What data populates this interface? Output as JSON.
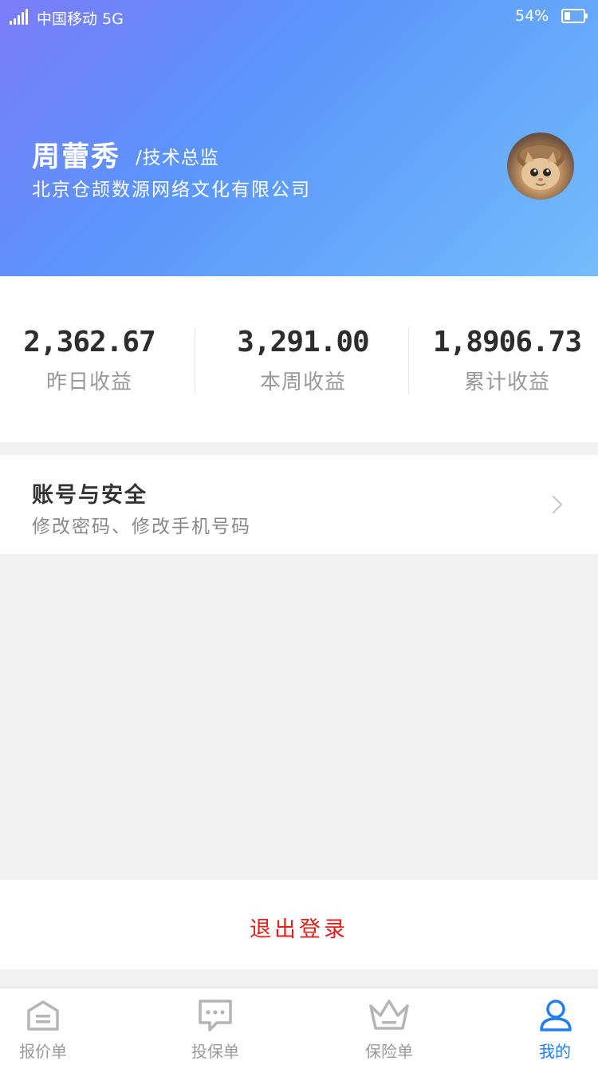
{
  "status_bar": {
    "carrier": "中国移动  5G",
    "battery_percent": "54%",
    "battery_level": 0.3
  },
  "profile": {
    "name": "周蕾秀",
    "title": "/技术总监",
    "company": "北京仓颉数源网络文化有限公司",
    "avatar_icon": "cat-avatar-icon"
  },
  "stats": [
    {
      "value": "2,362.67",
      "label": "昨日收益"
    },
    {
      "value": "3,291.00",
      "label": "本周收益"
    },
    {
      "value": "1,8906.73",
      "label": "累计收益"
    }
  ],
  "account": {
    "title": "账号与安全",
    "subtitle": "修改密码、修改手机号码"
  },
  "logout": {
    "label": "退出登录",
    "color": "#e0201b"
  },
  "tabbar": {
    "active_color": "#1f7ff0",
    "inactive_color": "#9a9a9a",
    "items": [
      {
        "label": "报价单",
        "icon": "house-icon"
      },
      {
        "label": "投保单",
        "icon": "chat-bubble-icon"
      },
      {
        "label": "保险单",
        "icon": "crown-icon"
      },
      {
        "label": "我的",
        "icon": "user-icon",
        "active": true
      }
    ]
  }
}
